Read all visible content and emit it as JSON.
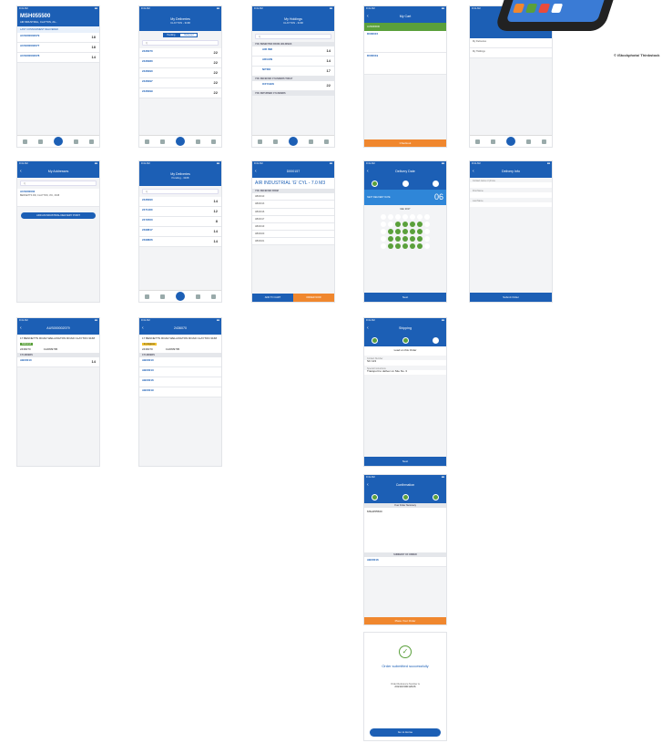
{
  "status_time": "9:41 AM",
  "screens": {
    "home": {
      "code": "MSH055500",
      "subtitle": "AIR INDUSTRIAL, CLAYTON, 2G...",
      "info": "LAST CONSIGNMENT DELIVERED",
      "rows": [
        {
          "id": "AUS000002079",
          "q": "18"
        },
        {
          "id": "AUS000002077",
          "q": "18"
        },
        {
          "id": "AUS000002078",
          "q": "14"
        }
      ]
    },
    "deliveries": {
      "title": "My Deliveries",
      "sub": "CLAYTON - 3168",
      "seg": [
        "Pending",
        "Delivered"
      ],
      "rows": [
        {
          "id": "2436070",
          "q": "22"
        },
        {
          "id": "2436080",
          "q": "22"
        },
        {
          "id": "2436090",
          "q": "22"
        },
        {
          "id": "2436097",
          "q": "22"
        },
        {
          "id": "2436099",
          "q": "22"
        },
        {
          "id": "2436100",
          "q": "22"
        }
      ]
    },
    "holdings": {
      "title": "My Holdings",
      "sub": "CLAYTON - 3168",
      "sections": [
        "YOU BENEFITED FROM HOLDINGS",
        "YOU RECEIVED CYLINDERS TODAY",
        "YOU RETURNED CYLINDERS"
      ],
      "rows": [
        {
          "id": "AIR IND",
          "q": "14"
        },
        {
          "id": "ARGON",
          "q": "14"
        },
        {
          "id": "NITRO",
          "q": "17"
        },
        {
          "id": "OXYGEN",
          "q": "22"
        },
        {
          "id": "ARGON",
          "q": "7"
        }
      ]
    },
    "cart": {
      "title": "My Cart",
      "band": "AUS000000",
      "rows": [
        {
          "id": "D000015"
        },
        {
          "id": "D000019"
        }
      ],
      "checkout": "Checkout"
    },
    "menu": {
      "items": [
        "My Deliveries",
        "My Holdings"
      ]
    },
    "addresses": {
      "title": "My Addresses",
      "entry": "AUS000002",
      "entry_sub": "BENNETTS RD, CLAYTON, VIC, 3168",
      "add": "ADD AN INDUSTRIAL DELIVERY POINT"
    },
    "deliveries2": {
      "title": "My Deliveries",
      "sub": "Pending - 3168",
      "rows": [
        {
          "id": "2436090",
          "q": "14"
        },
        {
          "id": "2471180",
          "q": "12"
        },
        {
          "id": "2472000",
          "q": "8"
        },
        {
          "id": "2498817",
          "q": "14"
        },
        {
          "id": "2498826",
          "q": "14"
        },
        {
          "id": "2498830",
          "q": "9"
        }
      ]
    },
    "product": {
      "title": "D000157",
      "name": "AIR INDUSTRIAL 'G' CYL - 7.0 M3",
      "section": "YOU RECEIVED FROM",
      "rows": [
        "AB00010",
        "AB00013",
        "AB00016",
        "AB00017",
        "AB00019",
        "AB00020",
        "AB00021",
        "AB00022",
        "AB00023"
      ],
      "add": "ADD TO CART",
      "order": "ORDER NOW"
    },
    "delivery_date": {
      "title": "Delivery Date",
      "band": "NEXT DELIVERY DATE",
      "day": "06",
      "month": "Mar 2017",
      "btn": "Next"
    },
    "delivery_info": {
      "title": "Delivery Info",
      "fields": [
        "Contact name or phone",
        "First Name",
        "Last Name"
      ],
      "btn": "Submit Order"
    },
    "detail1": {
      "title": "AUS000002079",
      "addr": "17 BENNETTS ROAD WELLINGTON ROAD CLAYTON 3168",
      "status": "Delivered",
      "order": "2436070",
      "po": "CL6839795",
      "items": "CYLINDERS",
      "row": "AB00010",
      "q": "14"
    },
    "detail2": {
      "title": "2436070",
      "addr": "17 BENNETTS ROAD WELLINGTON ROAD CLAYTON 3168",
      "status": "In progress",
      "order": "2436070",
      "po": "CL6839795",
      "items": "CYLINDERS",
      "rows": [
        "AB00010",
        "AB00013",
        "AB00016",
        "AB00019"
      ]
    },
    "shipping": {
      "title": "Shipping",
      "q": "Load on this Order",
      "f1": "Contact Number",
      "v1": "SC 123",
      "f2": "Special Instructions",
      "v2": "Transport to deliver on Site No. 3",
      "btn": "Next"
    },
    "confirm": {
      "title": "Confirmation",
      "band": "Your Order Summary",
      "name": "MSH055500",
      "items": "SUMMARY OF ORDER",
      "row": "AB00016",
      "btn": "Place Your Order"
    },
    "success": {
      "msg": "Order submitted successfully",
      "ref_label": "Order Reference Number is",
      "ref": "20211030012026",
      "btn": "Go to Home"
    }
  },
  "credit": "© iStockphoto/ Thinkstock",
  "colors": {
    "primary": "#1c5fb5",
    "accent": "#f0872e",
    "success": "#5aa03b"
  }
}
